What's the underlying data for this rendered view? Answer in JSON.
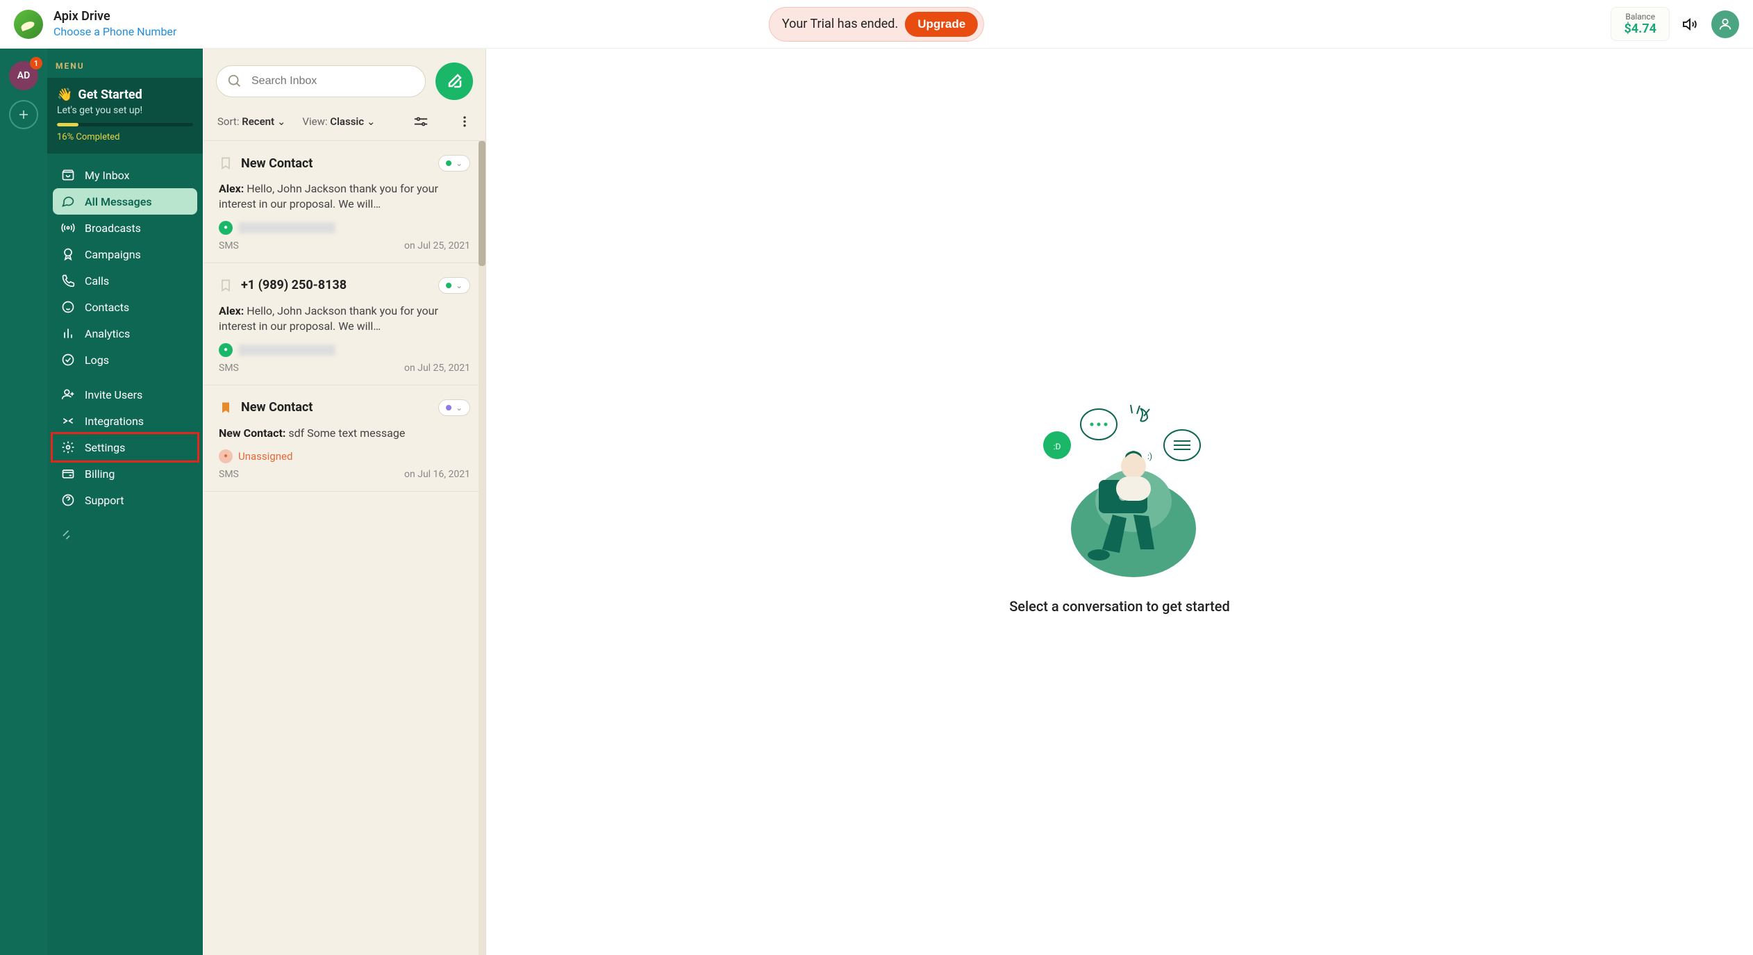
{
  "header": {
    "title": "Apix Drive",
    "subtitle": "Choose a Phone Number",
    "trial_text": "Your Trial has ended.",
    "upgrade_label": "Upgrade",
    "balance_label": "Balance",
    "balance_amount": "$4.74"
  },
  "strip": {
    "workspace_initials": "AD",
    "badge_count": "1"
  },
  "sidebar": {
    "menu_label": "MENU",
    "get_started": {
      "title": "Get Started",
      "subtitle": "Let's get you set up!",
      "percent_label": "16% Completed",
      "percent": 16
    },
    "items": [
      {
        "label": "My Inbox",
        "icon": "inbox"
      },
      {
        "label": "All Messages",
        "icon": "chat",
        "active": true
      },
      {
        "label": "Broadcasts",
        "icon": "broadcast"
      },
      {
        "label": "Campaigns",
        "icon": "award"
      },
      {
        "label": "Calls",
        "icon": "phone"
      },
      {
        "label": "Contacts",
        "icon": "face"
      },
      {
        "label": "Analytics",
        "icon": "bars"
      },
      {
        "label": "Logs",
        "icon": "check-circle"
      }
    ],
    "items2": [
      {
        "label": "Invite Users",
        "icon": "user-plus"
      },
      {
        "label": "Integrations",
        "icon": "merge"
      },
      {
        "label": "Settings",
        "icon": "gear",
        "highlight": true
      },
      {
        "label": "Billing",
        "icon": "card"
      },
      {
        "label": "Support",
        "icon": "help"
      }
    ]
  },
  "inbox": {
    "search_placeholder": "Search Inbox",
    "sort_label": "Sort:",
    "sort_value": "Recent",
    "view_label": "View:",
    "view_value": "Classic",
    "conversations": [
      {
        "title": "New Contact",
        "sender": "Alex:",
        "preview": "Hello, John Jackson thank you for your interest in our proposal. We will…",
        "channel": "SMS",
        "date": "on Jul 25, 2021",
        "status": "green",
        "bookmarked": false,
        "assigned_blur": true
      },
      {
        "title": "+1 (989) 250-8138",
        "sender": "Alex:",
        "preview": "Hello, John Jackson thank you for your interest in our proposal. We will…",
        "channel": "SMS",
        "date": "on Jul 25, 2021",
        "status": "green",
        "bookmarked": false,
        "assigned_blur": true
      },
      {
        "title": "New Contact",
        "sender": "New Contact:",
        "preview": "sdf Some text message",
        "channel": "SMS",
        "date": "on Jul 16, 2021",
        "status": "purple",
        "bookmarked": true,
        "unassigned_label": "Unassigned"
      }
    ]
  },
  "main": {
    "empty_text": "Select a conversation to get started"
  }
}
